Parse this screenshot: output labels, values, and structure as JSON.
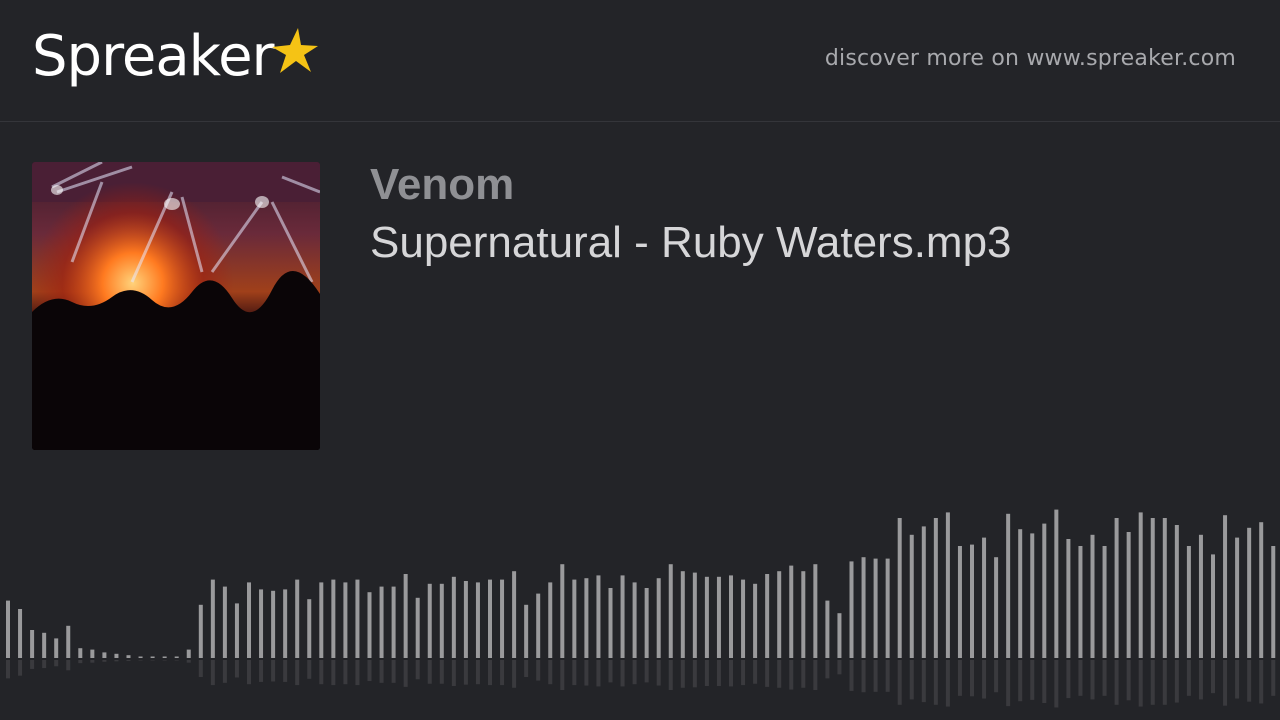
{
  "header": {
    "logo_text": "Spreaker",
    "logo_icon": "star-icon",
    "logo_star_color": "#f5c315",
    "discover_text": "discover more on www.spreaker.com"
  },
  "episode": {
    "show_title": "Venom",
    "title": "Supernatural - Ruby Waters.mp3",
    "cover_icon": "concert-stage-image"
  },
  "waveform": {
    "bar_color": "#9a9a9c",
    "reflection_color": "#3a3a3e",
    "levels": [
      0.41,
      0.35,
      0.2,
      0.18,
      0.14,
      0.23,
      0.07,
      0.06,
      0.04,
      0.03,
      0.02,
      0.01,
      0.01,
      0.01,
      0.01,
      0.06,
      0.38,
      0.56,
      0.51,
      0.39,
      0.54,
      0.49,
      0.48,
      0.49,
      0.56,
      0.42,
      0.54,
      0.56,
      0.54,
      0.56,
      0.47,
      0.51,
      0.51,
      0.6,
      0.43,
      0.53,
      0.53,
      0.58,
      0.55,
      0.54,
      0.56,
      0.56,
      0.62,
      0.38,
      0.46,
      0.54,
      0.67,
      0.56,
      0.57,
      0.59,
      0.5,
      0.59,
      0.54,
      0.5,
      0.57,
      0.67,
      0.62,
      0.61,
      0.58,
      0.58,
      0.59,
      0.56,
      0.53,
      0.6,
      0.62,
      0.66,
      0.62,
      0.67,
      0.41,
      0.32,
      0.69,
      0.72,
      0.71,
      0.71,
      1.0,
      0.88,
      0.94,
      1.0,
      1.04,
      0.8,
      0.81,
      0.86,
      0.72,
      1.03,
      0.92,
      0.89,
      0.96,
      1.06,
      0.85,
      0.8,
      0.88,
      0.8,
      1.0,
      0.9,
      1.04,
      1.0,
      1.0,
      0.95,
      0.8,
      0.88,
      0.74,
      1.02,
      0.86,
      0.93,
      0.97,
      0.8
    ]
  }
}
